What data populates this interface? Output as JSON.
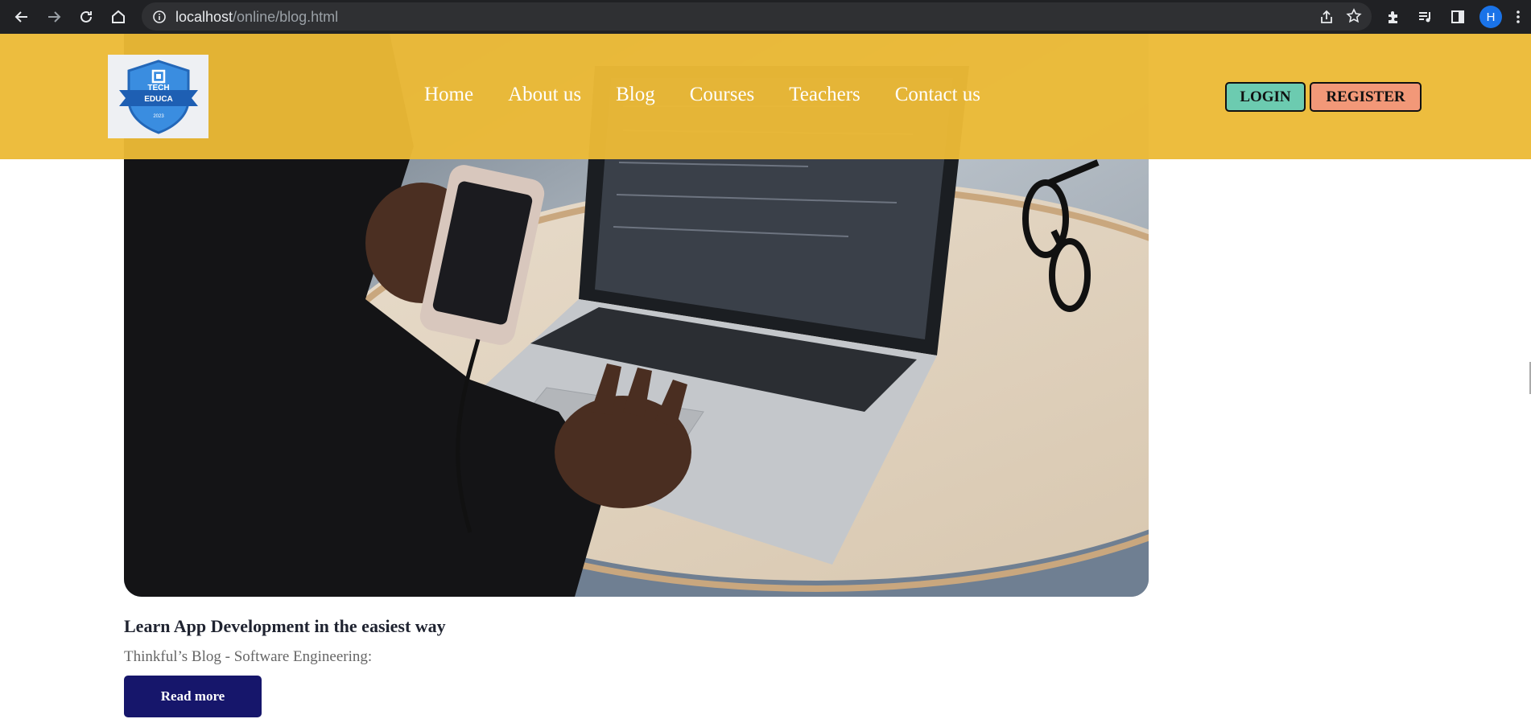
{
  "browser": {
    "url_host": "localhost",
    "url_path": "/online/blog.html",
    "profile_initial": "H",
    "icons": [
      "back-icon",
      "forward-icon",
      "reload-icon",
      "home-icon",
      "info-icon",
      "share-icon",
      "star-icon",
      "extensions-icon",
      "media-icon",
      "sidepanel-icon",
      "menu-icon"
    ]
  },
  "header": {
    "logo_text_line1": "TECH",
    "logo_text_line2": "EDUCA",
    "logo_year": "2023",
    "nav": [
      {
        "label": "Home"
      },
      {
        "label": "About us"
      },
      {
        "label": "Blog"
      },
      {
        "label": "Courses"
      },
      {
        "label": "Teachers"
      },
      {
        "label": "Contact us"
      }
    ],
    "login_label": "LOGIN",
    "register_label": "REGISTER",
    "colors": {
      "header_bg": "#ecba36",
      "login_bg": "#6ccbb0",
      "register_bg": "#f29878"
    }
  },
  "post": {
    "title": "Learn App Development in the easiest way",
    "subtitle": "Thinkful’s Blog - Software Engineering:",
    "read_more_label": "Read more",
    "button_color": "#16166b"
  }
}
